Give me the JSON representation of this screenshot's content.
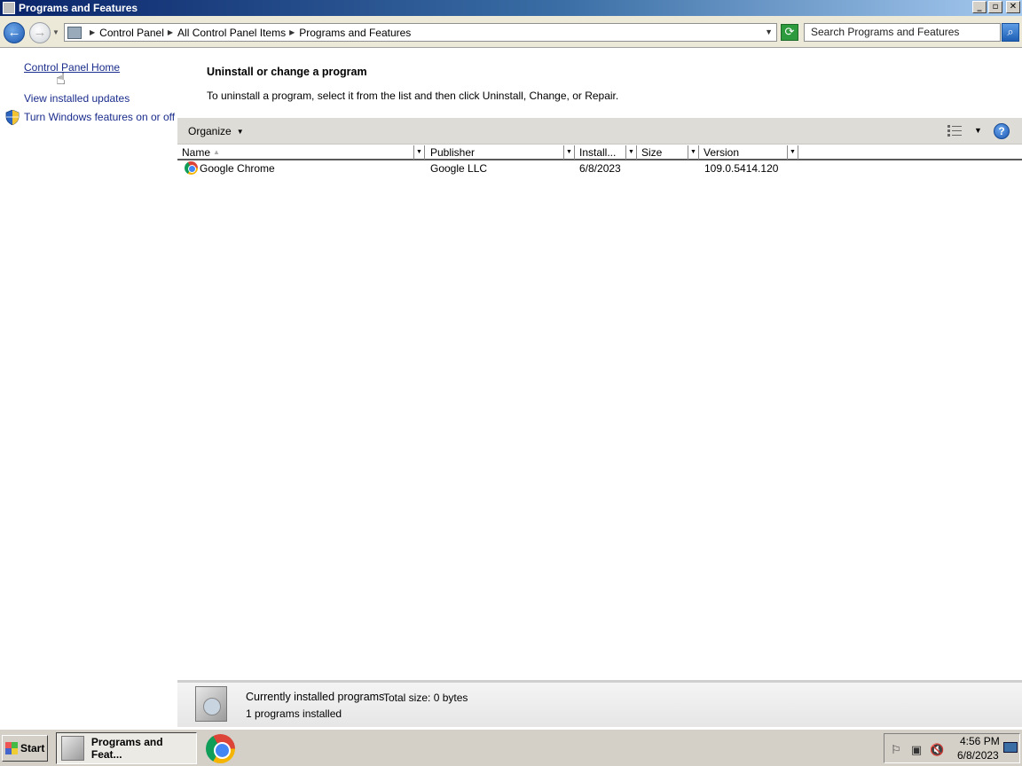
{
  "window": {
    "title": "Programs and Features",
    "controls": {
      "minimize": "_",
      "restore": "▫",
      "close": "✕"
    }
  },
  "address": {
    "breadcrumbs": [
      "Control Panel",
      "All Control Panel Items",
      "Programs and Features"
    ],
    "search_placeholder": "Search Programs and Features"
  },
  "left_pane": {
    "home_link": "Control Panel Home",
    "updates_link": "View installed updates",
    "features_link": "Turn Windows features on or off"
  },
  "main": {
    "title": "Uninstall or change a program",
    "description": "To uninstall a program, select it from the list and then click Uninstall, Change, or Repair."
  },
  "toolbar": {
    "organize_label": "Organize"
  },
  "list": {
    "columns": [
      "Name",
      "Publisher",
      "Install...",
      "Size",
      "Version"
    ],
    "rows": [
      {
        "name": "Google Chrome",
        "publisher": "Google LLC",
        "installed": "6/8/2023",
        "size": "",
        "version": "109.0.5414.120"
      }
    ]
  },
  "details": {
    "title": "Currently installed programs",
    "total_size": "Total size: 0 bytes",
    "count": "1 programs installed"
  },
  "taskbar": {
    "start_label": "Start",
    "task_label": "Programs and Feat...",
    "time": "4:56 PM",
    "date": "6/8/2023"
  }
}
